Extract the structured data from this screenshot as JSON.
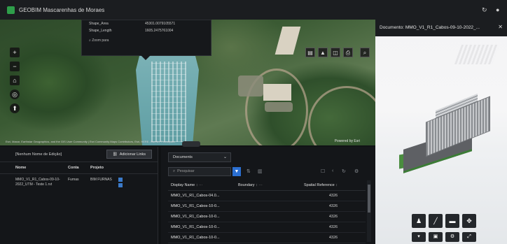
{
  "app": {
    "title": "GEOBIM Mascarenhas de Moraes"
  },
  "popup": {
    "rows": [
      {
        "key": "Shape_Area",
        "value": "45301.0079105571"
      },
      {
        "key": "Shape_Length",
        "value": "1605.2475761004"
      }
    ],
    "zoom_label": "Zoom para"
  },
  "map": {
    "attribution": "Esri, Maxar, Earthstar Geographics, and the GIS User Community | Esri Community Maps Contributors, Esri, HERE, Garmin, Foursquare",
    "credit": "Powered by Esri"
  },
  "left_panel": {
    "edition_name": "[Nenhum Nome de Edição]",
    "add_button": "Adicionar Links",
    "columns": [
      "Nome",
      "Conta",
      "Projeto"
    ],
    "rows": [
      {
        "nome": "MMO_V1_R1_Cabos-09-10-2022_UTM - Teste 1.rvt",
        "conta": "Furnas",
        "projeto": "BIM FURNAS"
      }
    ]
  },
  "doc_panel": {
    "selector": "Documents",
    "search_placeholder": "Pesquisar",
    "columns": [
      "Display Name",
      "Boundary",
      "Spatial Reference"
    ],
    "rows": [
      {
        "name": "MMO_V1_R1_Cabos-04.0...",
        "sr": "4326"
      },
      {
        "name": "MMO_V1_R1_Cabos-10-0...",
        "sr": "4326"
      },
      {
        "name": "MMO_V1_R1_Cabos-10-0...",
        "sr": "4326"
      },
      {
        "name": "MMO_V1_R1_Cabos-10-0...",
        "sr": "4326"
      },
      {
        "name": "MMO_V1_R1_Cabos-10-0...",
        "sr": "4326"
      }
    ]
  },
  "viewer": {
    "title": "Documento: MMO_V1_R1_Cabos-09-10-2022_..."
  },
  "icons": {
    "zoom_in": "+",
    "zoom_out": "−",
    "home": "⌂",
    "locate": "◎",
    "compass": "⬆",
    "close": "✕",
    "search": "⌕",
    "filter": "▼",
    "walk": "🚶",
    "measure": "📏",
    "section": "▬",
    "explode": "✥"
  },
  "colors": {
    "accent": "#2b6fd1",
    "brand": "#2e9e4a",
    "panel": "#141619"
  }
}
